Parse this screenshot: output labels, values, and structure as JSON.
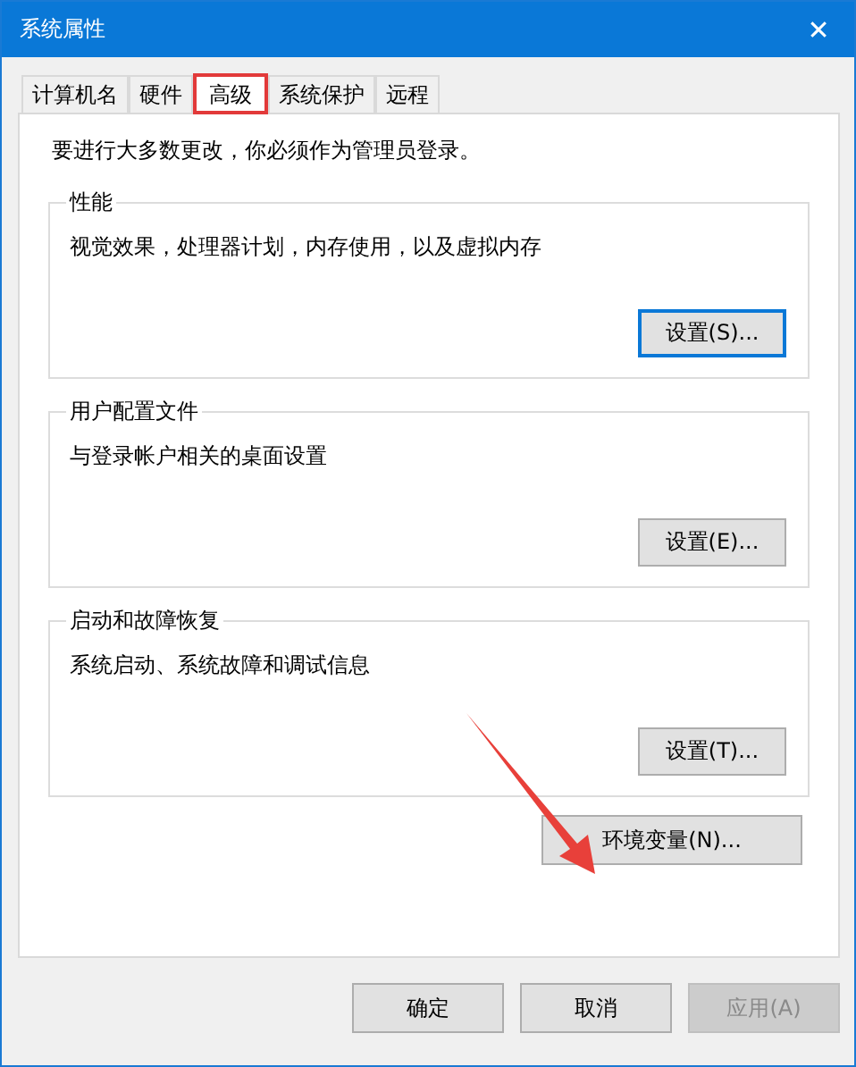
{
  "window": {
    "title": "系统属性",
    "close": "✕"
  },
  "tabs": [
    {
      "label": "计算机名",
      "selected": false,
      "highlighted": false
    },
    {
      "label": "硬件",
      "selected": false,
      "highlighted": false
    },
    {
      "label": "高级",
      "selected": true,
      "highlighted": true
    },
    {
      "label": "系统保护",
      "selected": false,
      "highlighted": false
    },
    {
      "label": "远程",
      "selected": false,
      "highlighted": false
    }
  ],
  "notice": "要进行大多数更改，你必须作为管理员登录。",
  "groups": [
    {
      "title": "性能",
      "description": "视觉效果，处理器计划，内存使用，以及虚拟内存",
      "button": "设置(S)...",
      "focused": true
    },
    {
      "title": "用户配置文件",
      "description": "与登录帐户相关的桌面设置",
      "button": "设置(E)...",
      "focused": false
    },
    {
      "title": "启动和故障恢复",
      "description": "系统启动、系统故障和调试信息",
      "button": "设置(T)...",
      "focused": false
    }
  ],
  "env_button": "环境变量(N)...",
  "buttons": [
    {
      "label": "确定",
      "disabled": false
    },
    {
      "label": "取消",
      "disabled": false
    },
    {
      "label": "应用(A)",
      "disabled": true
    }
  ]
}
